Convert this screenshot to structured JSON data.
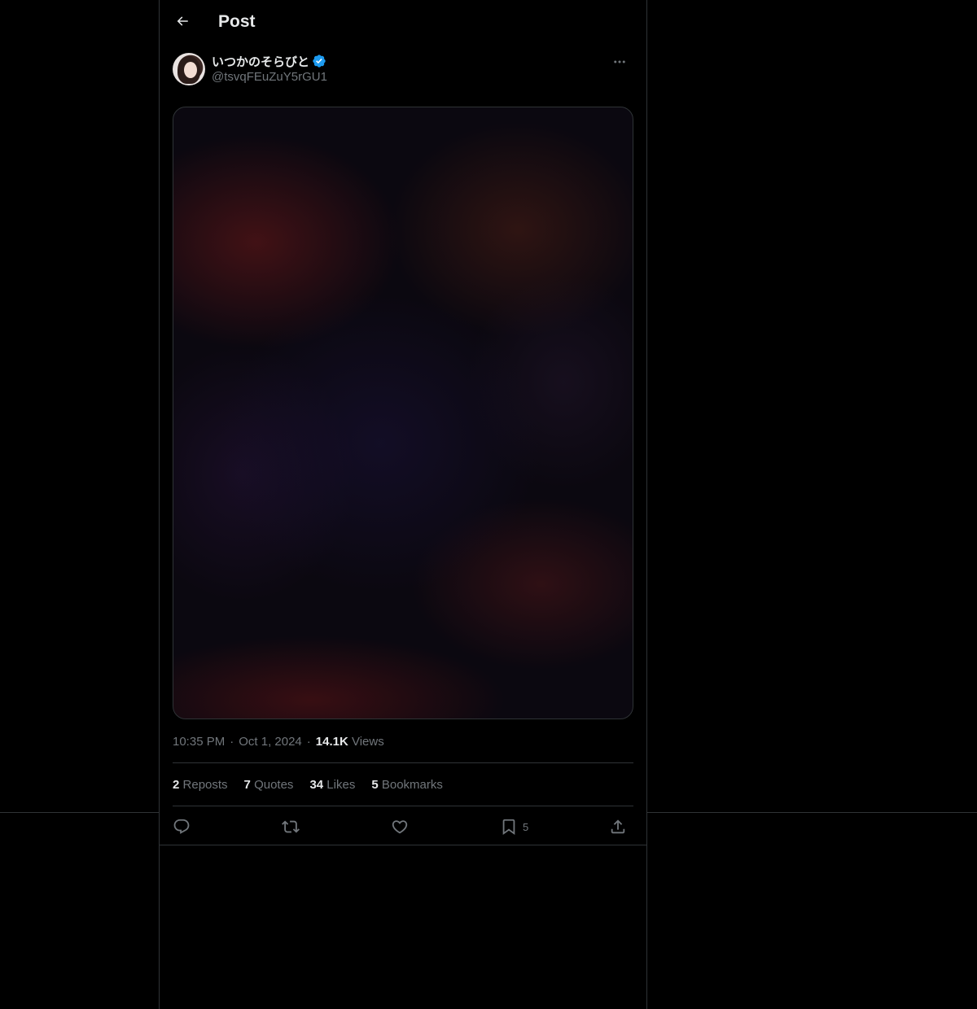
{
  "topbar": {
    "back_icon": "arrow-left-icon",
    "title": "Post"
  },
  "author": {
    "display_name": "いつかのそらびと",
    "verified_icon": "verified-badge-icon",
    "verified_color": "#1d9bf0",
    "handle": "@tsvqFEuZuY5rGU1",
    "more_icon": "more-horizontal-icon"
  },
  "post": {
    "time": "10:35 PM",
    "date": "Oct 1, 2024",
    "views_count": "14.1K",
    "views_label": "Views"
  },
  "stats": {
    "reposts_count": "2",
    "reposts_label": "Reposts",
    "quotes_count": "7",
    "quotes_label": "Quotes",
    "likes_count": "34",
    "likes_label": "Likes",
    "bookmarks_count": "5",
    "bookmarks_label": "Bookmarks"
  },
  "actions": {
    "reply_icon": "reply-icon",
    "repost_icon": "repost-icon",
    "like_icon": "heart-icon",
    "bookmark_icon": "bookmark-icon",
    "bookmark_count": "5",
    "share_icon": "share-icon"
  },
  "colors": {
    "background": "#000000",
    "primary_text": "#e7e9ea",
    "secondary_text": "#71767b",
    "border": "#2f3336",
    "accent": "#1d9bf0"
  }
}
